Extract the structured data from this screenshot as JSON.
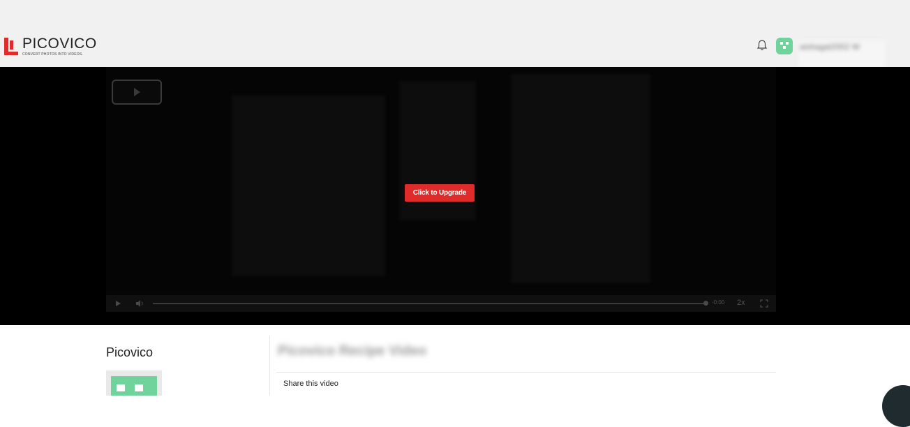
{
  "header": {
    "logo_title": "PICOVICO",
    "logo_tagline": "CONVERT PHOTOS INTO VIDEOS.",
    "username": "aishagal2002 W",
    "colors": {
      "brand_red": "#e02b2b",
      "avatar_green": "#6fd39b"
    }
  },
  "player": {
    "upgrade_label": "Click to Upgrade",
    "time_remaining": "-0:00",
    "playback_speed": "2x"
  },
  "details": {
    "channel_name": "Picovico",
    "video_title": "Picovico Recipe Video",
    "share_label": "Share this video"
  }
}
